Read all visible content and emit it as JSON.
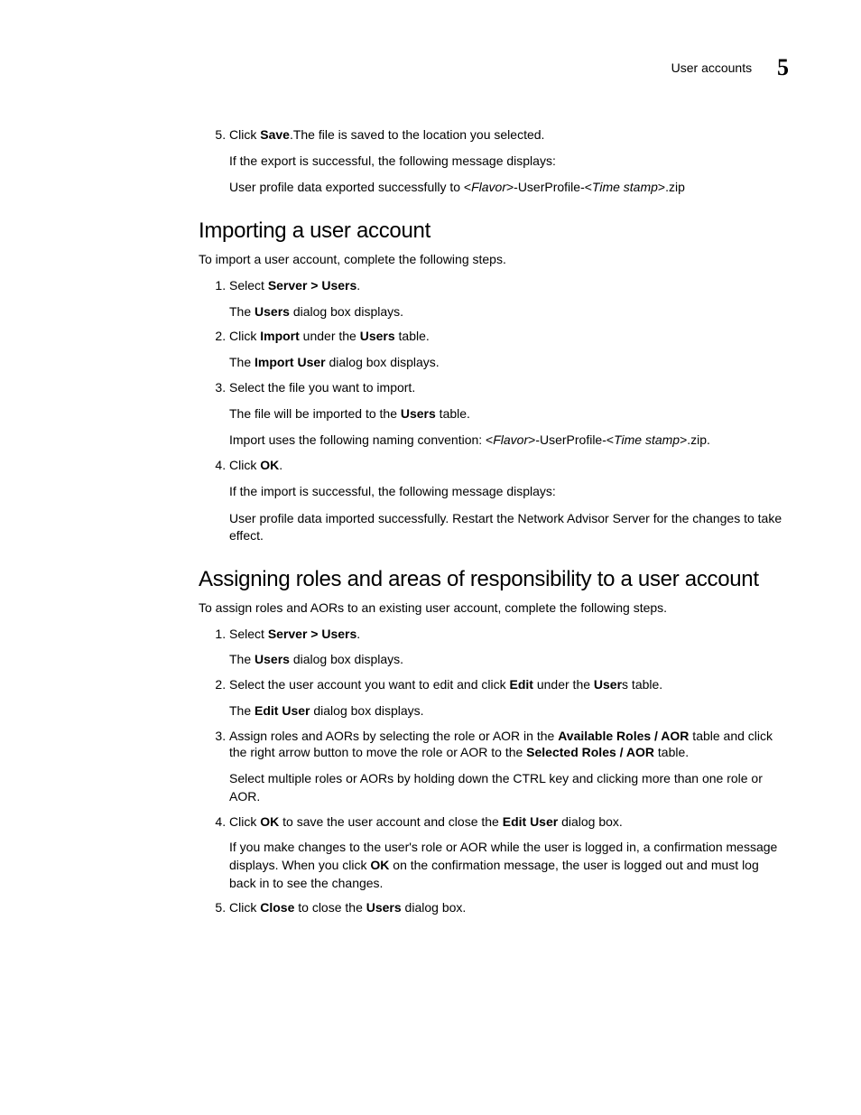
{
  "header": {
    "title": "User accounts",
    "chapter": "5"
  },
  "topSection": {
    "items": [
      {
        "num": "5.",
        "main_pre": "Click ",
        "main_bold": "Save",
        "main_post": ".The file is saved to the location you selected.",
        "sub1": "If the export is successful, the following message displays:",
        "sub2_pre": "User profile data exported successfully to <",
        "sub2_i1": "Flavor",
        "sub2_mid": ">-UserProfile-<",
        "sub2_i2": "Time stamp",
        "sub2_post": ">.zip"
      }
    ]
  },
  "section1": {
    "heading": "Importing a user account",
    "intro": "To import a user account, complete the following steps.",
    "steps": {
      "s1": {
        "pre": "Select ",
        "bold": "Server > Users",
        "post": ".",
        "sub_pre": "The ",
        "sub_bold": "Users",
        "sub_post": " dialog box displays."
      },
      "s2": {
        "pre": "Click ",
        "b1": "Import",
        "mid": " under the ",
        "b2": "Users",
        "post": " table.",
        "sub_pre": "The ",
        "sub_bold": "Import User",
        "sub_post": " dialog box displays."
      },
      "s3": {
        "main": "Select the file you want to import.",
        "sub1_pre": "The file will be imported to the ",
        "sub1_bold": "Users",
        "sub1_post": " table.",
        "sub2_pre": "Import uses the following naming convention: <",
        "sub2_i1": "Flavor",
        "sub2_mid": ">-UserProfile-<",
        "sub2_i2": "Time stamp",
        "sub2_post": ">.zip."
      },
      "s4": {
        "pre": "Click ",
        "bold": "OK",
        "post": ".",
        "sub1": "If the import is successful, the following message displays:",
        "sub2": "User profile data imported successfully. Restart the Network Advisor Server for the changes to take effect."
      }
    }
  },
  "section2": {
    "heading": "Assigning roles and areas of responsibility to a user account",
    "intro": "To assign roles and AORs to an existing user account, complete the following steps.",
    "steps": {
      "s1": {
        "pre": "Select ",
        "bold": "Server > Users",
        "post": ".",
        "sub_pre": "The ",
        "sub_bold": "Users",
        "sub_post": " dialog box displays."
      },
      "s2": {
        "pre": "Select the user account you want to edit and click ",
        "b1": "Edit",
        "mid": " under the ",
        "b2": "User",
        "post": "s table.",
        "sub_pre": "The ",
        "sub_bold": "Edit User",
        "sub_post": " dialog box displays."
      },
      "s3": {
        "pre": "Assign roles and AORs by selecting the role or AOR in the ",
        "b1": "Available Roles / AOR",
        "mid": " table and click the right arrow button to move the role or AOR to the ",
        "b2": "Selected Roles / AOR",
        "post": " table.",
        "sub": "Select multiple roles or AORs by holding down the CTRL key and clicking more than one role or AOR."
      },
      "s4": {
        "pre": "Click ",
        "b1": "OK",
        "mid": " to save the user account and close the ",
        "b2": "Edit User",
        "post": " dialog box.",
        "sub_pre": "If you make changes to the user's role or AOR while the user is logged in, a confirmation message displays. When you click ",
        "sub_bold": "OK",
        "sub_post": " on the confirmation message, the user is logged out and must log back in to see the changes."
      },
      "s5": {
        "pre": "Click ",
        "b1": "Close",
        "mid": " to close the ",
        "b2": "Users",
        "post": " dialog box."
      }
    }
  }
}
